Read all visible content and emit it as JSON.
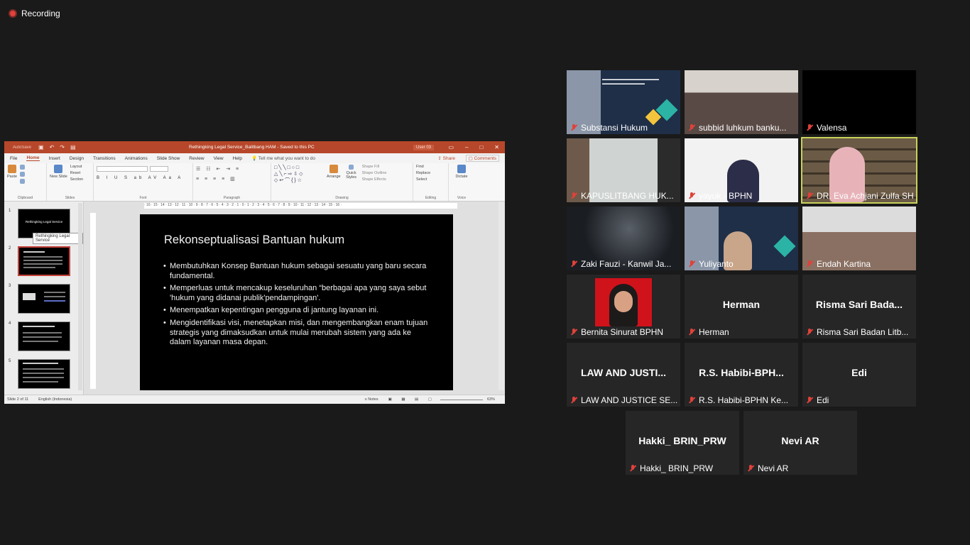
{
  "recording": {
    "label": "Recording"
  },
  "ppt": {
    "autosave": "AutoSave",
    "doc_title": "Rethingking Legal Service_Balitbang HAM  -  Saved to this PC",
    "user": "User 03",
    "tabs": [
      "File",
      "Home",
      "Insert",
      "Design",
      "Transitions",
      "Animations",
      "Slide Show",
      "Review",
      "View",
      "Help"
    ],
    "tell_me": "Tell me what you want to do",
    "share": "Share",
    "comments": "Comments",
    "groups": {
      "clipboard": "Clipboard",
      "paste": "Paste",
      "slides": "Slides",
      "new_slide": "New Slide",
      "layout": "Layout",
      "reset": "Reset",
      "section": "Section",
      "font": "Font",
      "paragraph": "Paragraph",
      "drawing": "Drawing",
      "arrange": "Arrange",
      "quick_styles": "Quick Styles",
      "shape_fill": "Shape Fill",
      "shape_outline": "Shape Outline",
      "shape_effects": "Shape Effects",
      "editing": "Editing",
      "find": "Find",
      "replace": "Replace",
      "select": "Select",
      "voice": "Voice",
      "dictate": "Dictate"
    },
    "thumb_numbers": [
      "1",
      "2",
      "3",
      "4",
      "5"
    ],
    "thumb1_title": "Rethingking Legal Service",
    "tooltip": "Rethingking Legal Service",
    "ruler": "· 16 · 15 · 14 · 13 · 12 · 11 · 10 · 9 · 8 · 7 · 6 · 5 · 4 · 3 · 2 · 1 · 0 · 1 · 2 · 3 · 4 · 5 · 6 · 7 · 8 · 9 · 10 · 11 · 12 · 13 · 14 · 15 · 16 ·",
    "slide": {
      "title": "Rekonseptualisasi Bantuan hukum",
      "bullets": [
        "Membutuhkan Konsep Bantuan hukum  sebagai sesuatu yang baru secara fundamental.",
        "Memperluas untuk mencakup keseluruhan “berbagai apa yang saya sebut 'hukum yang didanai publik'pendampingan'.",
        "Menempatkan kepentingan pengguna di jantung layanan ini.",
        "Mengidentifikasi visi, menetapkan misi, dan mengembangkan enam tujuan strategis yang dimaksudkan untuk mulai merubah sistem yang ada ke dalam layanan masa depan."
      ]
    },
    "status": {
      "slide": "Slide 2 of 11",
      "lang": "English (Indonesia)",
      "notes": "Notes",
      "zoom": "63%"
    }
  },
  "participants": [
    {
      "name": "Substansi Hukum",
      "big": ""
    },
    {
      "name": "subbid luhkum banku...",
      "big": ""
    },
    {
      "name": "Valensa",
      "big": ""
    },
    {
      "name": "KAPUSLITBANG HUK...",
      "big": ""
    },
    {
      "name": "yayuk - BPHN",
      "big": ""
    },
    {
      "name": "DR. Eva Achjani Zulfa SH...",
      "big": ""
    },
    {
      "name": "Zaki Fauzi - Kanwil Ja...",
      "big": ""
    },
    {
      "name": "Yuliyanto",
      "big": ""
    },
    {
      "name": "Endah Kartina",
      "big": ""
    },
    {
      "name": "Bernita Sinurat BPHN",
      "big": ""
    },
    {
      "name": "Herman",
      "big": "Herman"
    },
    {
      "name": "Risma Sari Badan Litb...",
      "big": "Risma Sari Bada..."
    },
    {
      "name": "LAW AND JUSTICE SE...",
      "big": "LAW AND JUSTI..."
    },
    {
      "name": "R.S. Habibi-BPHN Ke...",
      "big": "R.S.  Habibi-BPH..."
    },
    {
      "name": "Edi",
      "big": "Edi"
    },
    {
      "name": "Hakki_ BRIN_PRW",
      "big": "Hakki_ BRIN_PRW"
    },
    {
      "name": "Nevi AR",
      "big": "Nevi AR"
    }
  ],
  "colors": {
    "accent": "#b7472a",
    "muted": "#e0413a",
    "active_speaker": "#c9d25a"
  }
}
